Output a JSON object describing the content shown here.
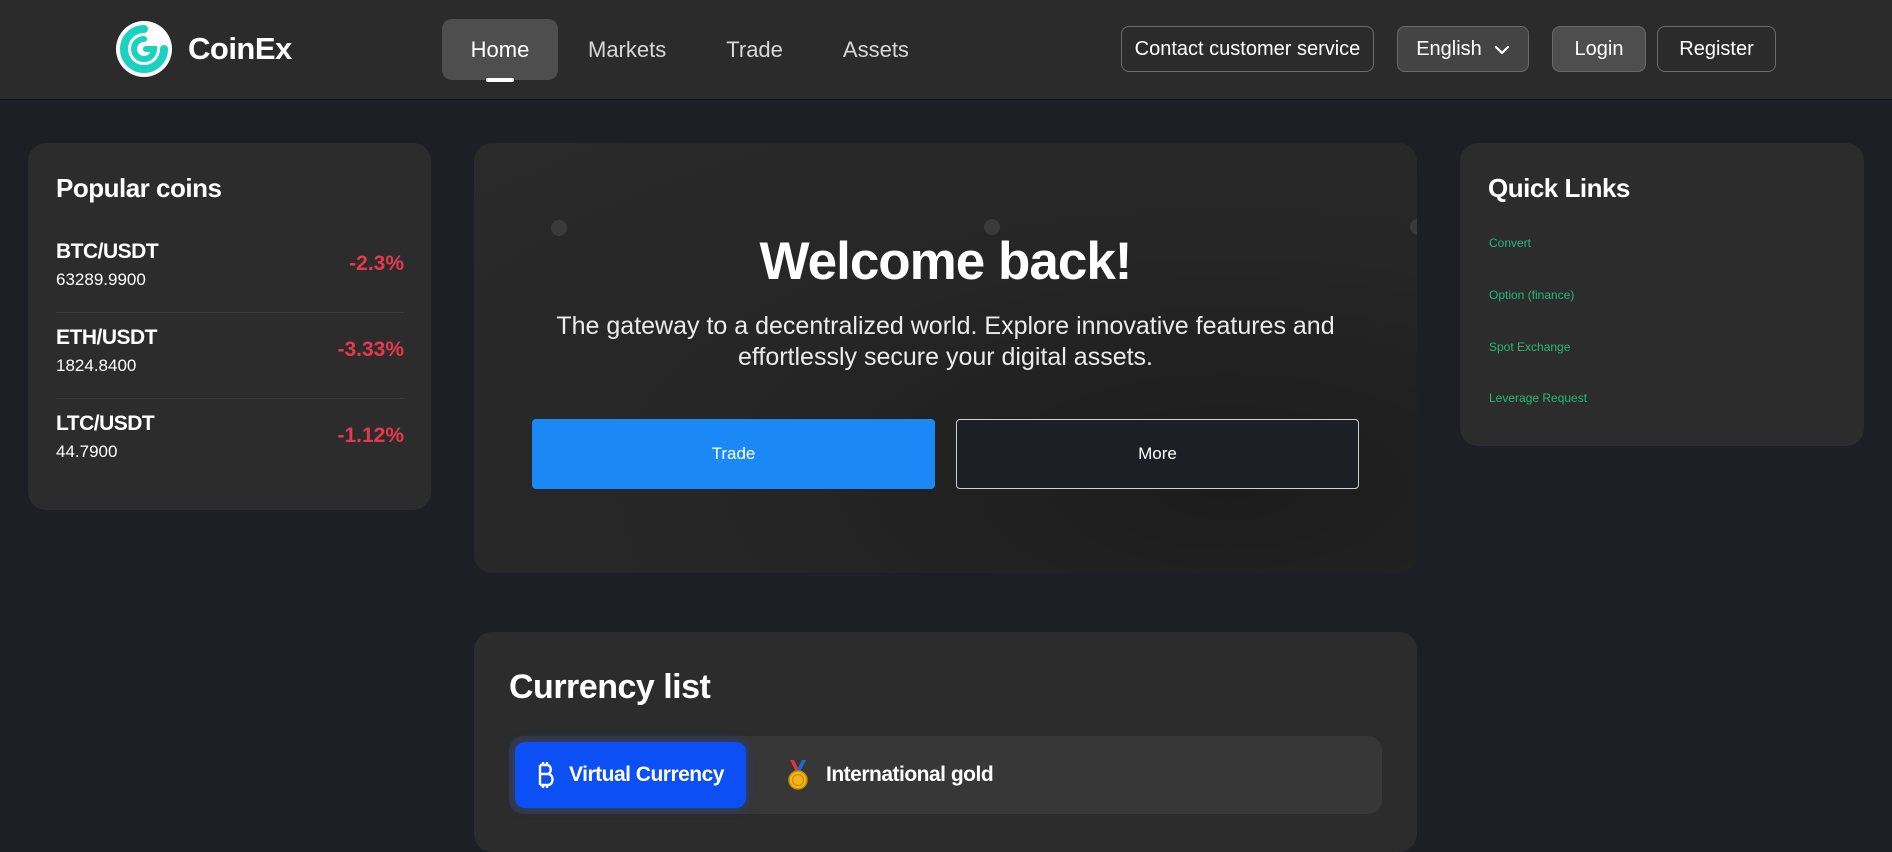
{
  "header": {
    "brand": "CoinEx",
    "nav": [
      {
        "label": "Home",
        "active": true
      },
      {
        "label": "Markets",
        "active": false
      },
      {
        "label": "Trade",
        "active": false
      },
      {
        "label": "Assets",
        "active": false
      }
    ],
    "contact_label": "Contact customer service",
    "language_label": "English",
    "login_label": "Login",
    "register_label": "Register"
  },
  "popular": {
    "title": "Popular coins",
    "coins": [
      {
        "pair": "BTC/USDT",
        "price": "63289.9900",
        "change": "-2.3%"
      },
      {
        "pair": "ETH/USDT",
        "price": "1824.8400",
        "change": "-3.33%"
      },
      {
        "pair": "LTC/USDT",
        "price": "44.7900",
        "change": "-1.12%"
      }
    ]
  },
  "welcome": {
    "title": "Welcome back!",
    "subtitle": "The gateway to a decentralized world. Explore innovative features and effortlessly secure your digital assets.",
    "trade_label": "Trade",
    "more_label": "More"
  },
  "quick_links": {
    "title": "Quick Links",
    "links": [
      "Convert",
      "Option (finance)",
      "Spot Exchange",
      "Leverage Request"
    ]
  },
  "currency": {
    "title": "Currency list",
    "tabs": [
      {
        "label": "Virtual Currency",
        "icon": "bitcoin-icon",
        "active": true
      },
      {
        "label": "International gold",
        "icon": "medal-icon",
        "active": false
      }
    ]
  },
  "colors": {
    "accent_blue": "#1a88f5",
    "tab_blue": "#0c4ff5",
    "negative": "#e8384f",
    "link_green": "#25b77d",
    "logo_teal": "#1bd1c0"
  }
}
